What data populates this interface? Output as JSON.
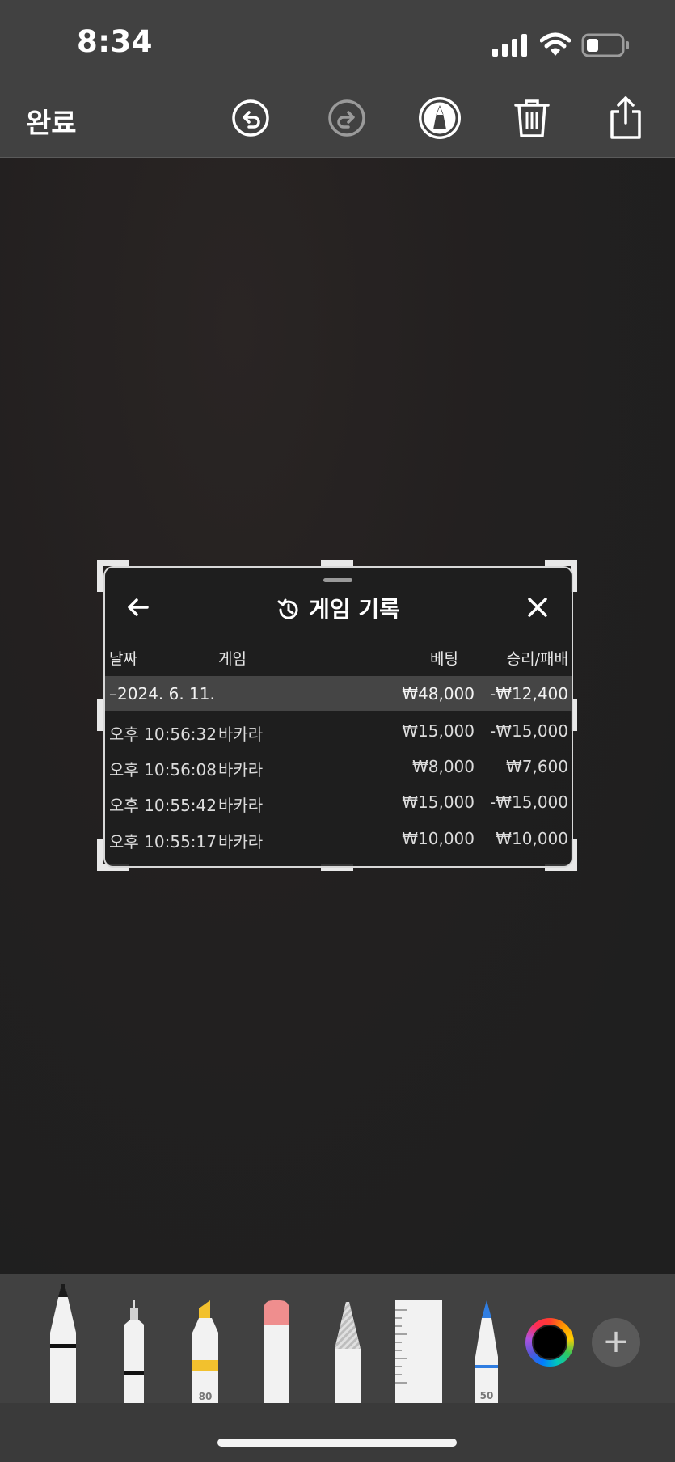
{
  "status": {
    "time": "8:34"
  },
  "toolbar": {
    "done_label": "완료",
    "icons": [
      "undo-icon",
      "redo-icon",
      "markup-pen-icon",
      "trash-icon",
      "share-icon"
    ]
  },
  "card": {
    "title": "게임 기록",
    "icons": [
      "back-arrow-icon",
      "history-icon",
      "close-icon"
    ],
    "columns": {
      "date": "날짜",
      "game": "게임",
      "bet": "베팅",
      "result": "승리/패배"
    },
    "group": {
      "date": "–2024. 6. 11.",
      "bet": "₩48,000",
      "result": "-₩12,400"
    },
    "rows": [
      {
        "time": "오후 10:56:32",
        "game": "바카라",
        "bet": "₩15,000",
        "result": "-₩15,000"
      },
      {
        "time": "오후 10:56:08",
        "game": "바카라",
        "bet": "₩8,000",
        "result": "₩7,600"
      },
      {
        "time": "오후 10:55:42",
        "game": "바카라",
        "bet": "₩15,000",
        "result": "-₩15,000"
      },
      {
        "time": "오후 10:55:17",
        "game": "바카라",
        "bet": "₩10,000",
        "result": "₩10,000"
      }
    ]
  },
  "tools": {
    "highlighter_size": "80",
    "crayon_size": "50",
    "items": [
      "pen-tool",
      "fineliner-tool",
      "highlighter-tool",
      "eraser-tool",
      "pencil-tool",
      "ruler-tool",
      "crayon-tool"
    ],
    "plus_label": "+"
  },
  "colors": {
    "bar": "#414141",
    "accent_highlighter": "#f2c12e",
    "accent_crayon": "#2f7de1",
    "eraser": "#ef8e8e"
  }
}
